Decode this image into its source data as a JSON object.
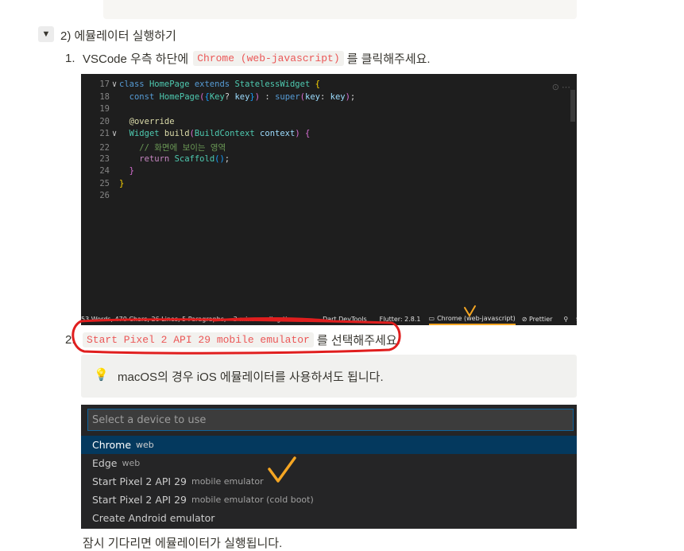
{
  "toggle_section": {
    "toggle_icon": "▼",
    "title": "2) 에뮬레이터 실행하기"
  },
  "steps": [
    {
      "num": "1.",
      "before": "VSCode 우측 하단에",
      "code": "Chrome (web-javascript)",
      "after": "를 클릭해주세요."
    },
    {
      "num": "2.",
      "code": "Start Pixel 2 API 29 mobile emulator",
      "after": "를 선택해주세요."
    }
  ],
  "code_editor": {
    "top_partial_line": "16",
    "lines": [
      {
        "n": "17",
        "fold": "∨",
        "html": "<span style='color:#569cd6'>class</span> <span style='color:#4ec9b0'>HomePage</span> <span style='color:#569cd6'>extends</span> <span style='color:#4ec9b0'>StatelessWidget</span> <span style='color:#ffd700'>{</span>"
      },
      {
        "n": "18",
        "fold": "",
        "html": "  <span style='color:#569cd6'>const</span> <span style='color:#4ec9b0'>HomePage</span><span style='color:#da70d6'>(</span><span style='color:#179fff'>{</span><span style='color:#4ec9b0'>Key</span><span style='color:#d4d4d4'>?</span> <span style='color:#9cdcfe'>key</span><span style='color:#179fff'>}</span><span style='color:#da70d6'>)</span> <span style='color:#d4d4d4'>:</span> <span style='color:#569cd6'>super</span><span style='color:#da70d6'>(</span><span style='color:#9cdcfe'>key</span><span style='color:#d4d4d4'>:</span> <span style='color:#9cdcfe'>key</span><span style='color:#da70d6'>)</span><span style='color:#d4d4d4'>;</span>"
      },
      {
        "n": "19",
        "fold": "",
        "html": ""
      },
      {
        "n": "20",
        "fold": "",
        "html": "  <span style='color:#dcdcaa'>@override</span>"
      },
      {
        "n": "21",
        "fold": "∨",
        "html": "  <span style='color:#4ec9b0'>Widget</span> <span style='color:#dcdcaa'>build</span><span style='color:#da70d6'>(</span><span style='color:#4ec9b0'>BuildContext</span> <span style='color:#9cdcfe'>context</span><span style='color:#da70d6'>)</span> <span style='color:#da70d6'>{</span>"
      },
      {
        "n": "22",
        "fold": "",
        "html": "    <span style='color:#6a9955'>// 화면에 보이는 영역</span>"
      },
      {
        "n": "23",
        "fold": "",
        "html": "    <span style='color:#c586c0'>return</span> <span style='color:#4ec9b0'>Scaffold</span><span style='color:#179fff'>()</span><span style='color:#d4d4d4'>;</span>"
      },
      {
        "n": "24",
        "fold": "",
        "html": "  <span style='color:#da70d6'>}</span>"
      },
      {
        "n": "25",
        "fold": "",
        "html": "<span style='color:#ffd700'>}</span>"
      },
      {
        "n": "26",
        "fold": "",
        "html": ""
      }
    ],
    "statusbar": {
      "words": "53 Words, 470 Chars, 26 Lines, 5 Paragraphs, ~3 mins reading time",
      "devtools": "Dart DevTools",
      "flutter": "Flutter: 2.8.1",
      "device": "Chrome (web-javascript)",
      "prettier": "Prettier"
    }
  },
  "callout": {
    "icon": "💡",
    "text": "macOS의 경우 iOS 에뮬레이터를 사용하셔도 됩니다."
  },
  "device_picker": {
    "placeholder": "Select a device to use",
    "items": [
      {
        "label": "Chrome",
        "desc": "web",
        "selected": true
      },
      {
        "label": "Edge",
        "desc": "web",
        "selected": false
      },
      {
        "label": "Start Pixel 2 API 29",
        "desc": "mobile emulator",
        "selected": false
      },
      {
        "label": "Start Pixel 2 API 29",
        "desc": "mobile emulator (cold boot)",
        "selected": false
      },
      {
        "label": "Create Android emulator",
        "desc": "",
        "selected": false
      }
    ]
  },
  "footer_partial_text": "잠시 기다리면 에뮬레이터가 실행됩니다.",
  "annotation_colors": {
    "red_circle": "#e01e1e",
    "checkmark": "#f5a623"
  }
}
